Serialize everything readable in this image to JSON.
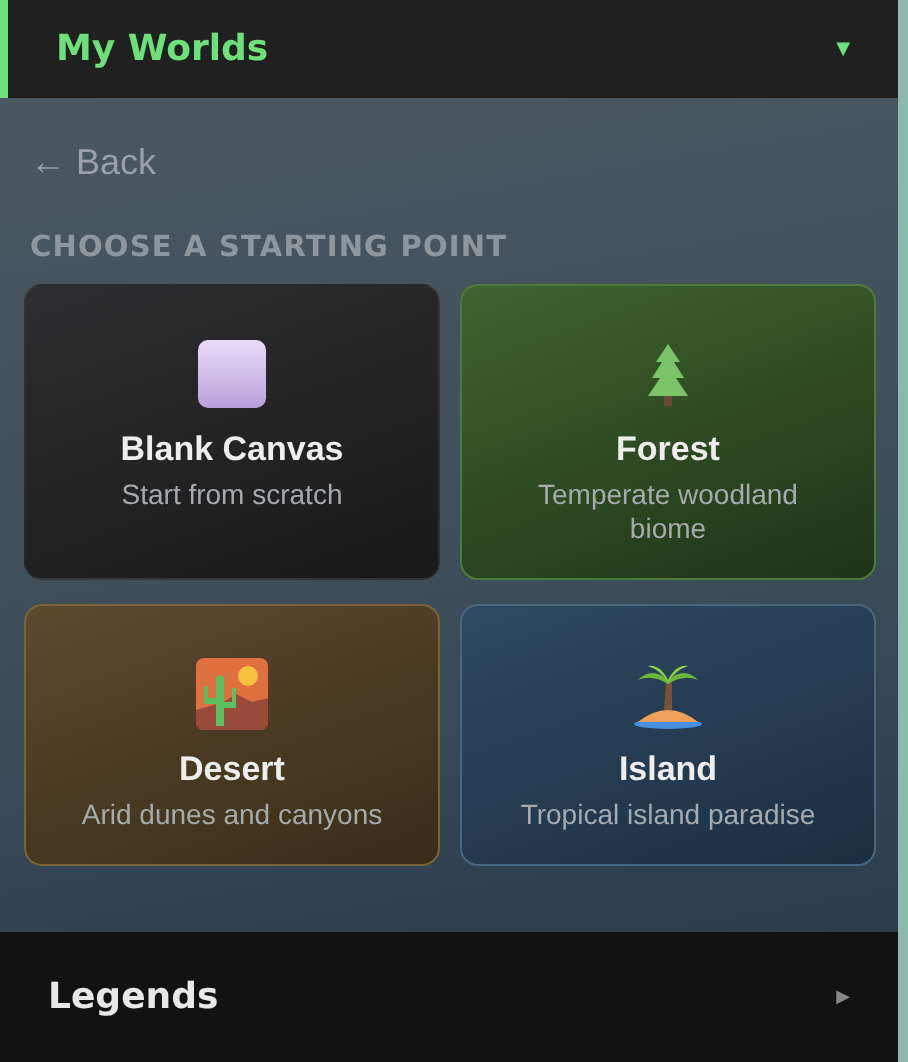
{
  "sections": [
    {
      "title": "My Worlds",
      "caret": "▼",
      "expanded": true,
      "back_link": "← Back",
      "heading": "CHOOSE A STARTING POINT",
      "cards": [
        {
          "kind": "blank",
          "title": "Blank Canvas",
          "description": "Start from scratch"
        },
        {
          "kind": "forest",
          "title": "Forest",
          "description": "Temperate woodland biome"
        },
        {
          "kind": "desert",
          "title": "Desert",
          "description": "Arid dunes and canyons"
        },
        {
          "kind": "island",
          "title": "Island",
          "description": "Tropical island paradise"
        }
      ]
    },
    {
      "title": "Legends",
      "caret": "▶",
      "expanded": false
    }
  ]
}
